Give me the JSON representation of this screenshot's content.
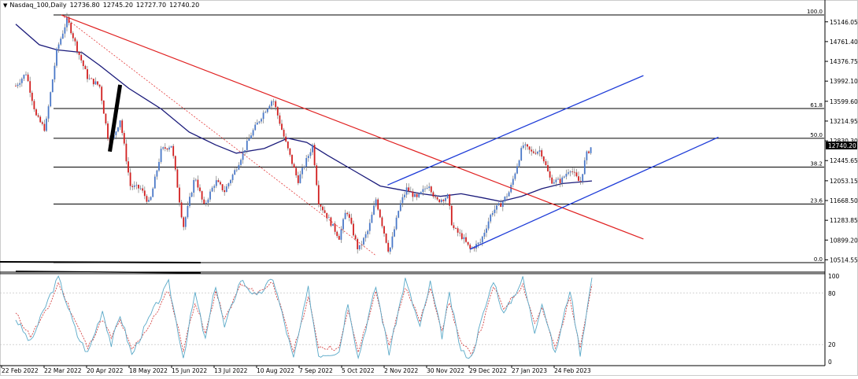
{
  "header": {
    "symbol": "Nasdaq_100,Daily",
    "ohlc": [
      "12736.80",
      "12745.20",
      "12727.70",
      "12740.20"
    ]
  },
  "colors": {
    "bull_candle": "#4a78c8",
    "bear_candle": "#d11f1f",
    "wick": "#777777",
    "moving_average": "#1a1a7a",
    "downtrend_line": "#e02020",
    "channel_lines": "#1e3cd8",
    "fib_lines": "#000000",
    "stoch_main": "#5aa9c8",
    "stoch_signal": "#d03030",
    "price_badge": "#000000"
  },
  "chart_data": [
    {
      "type": "candlestick",
      "symbol": "Nasdaq_100",
      "timeframe": "Daily",
      "last_price": "12740.20",
      "ylim": [
        10400,
        15500
      ],
      "price_axis_ticks": [
        "15146.05",
        "14761.40",
        "14376.75",
        "13992.10",
        "13599.60",
        "13214.95",
        "12830.30",
        "12445.65",
        "12053.15",
        "11668.50",
        "11283.85",
        "10899.20",
        "10514.55"
      ],
      "date_axis_labels": [
        "22 Feb 2022",
        "22 Mar 2022",
        "20 Apr 2022",
        "18 May 2022",
        "15 Jun 2022",
        "13 Jul 2022",
        "10 Aug 2022",
        "7 Sep 2022",
        "5 Oct 2022",
        "2 Nov 2022",
        "30 Nov 2022",
        "29 Dec 2022",
        "27 Jan 2023",
        "24 Feb 2023"
      ],
      "price_path": [
        [
          "2022-02-22",
          13900
        ],
        [
          "2022-03-01",
          14150
        ],
        [
          "2022-03-08",
          13300
        ],
        [
          "2022-03-14",
          13050
        ],
        [
          "2022-03-22",
          14600
        ],
        [
          "2022-03-29",
          15200
        ],
        [
          "2022-04-05",
          14600
        ],
        [
          "2022-04-12",
          14050
        ],
        [
          "2022-04-20",
          13900
        ],
        [
          "2022-04-26",
          12850
        ],
        [
          "2022-04-29",
          12850
        ],
        [
          "2022-05-04",
          13250
        ],
        [
          "2022-05-11",
          11950
        ],
        [
          "2022-05-18",
          11900
        ],
        [
          "2022-05-24",
          11600
        ],
        [
          "2022-06-01",
          12650
        ],
        [
          "2022-06-08",
          12750
        ],
        [
          "2022-06-16",
          11150
        ],
        [
          "2022-06-24",
          12150
        ],
        [
          "2022-06-30",
          11550
        ],
        [
          "2022-07-08",
          12050
        ],
        [
          "2022-07-14",
          11850
        ],
        [
          "2022-07-22",
          12300
        ],
        [
          "2022-08-01",
          12950
        ],
        [
          "2022-08-10",
          13400
        ],
        [
          "2022-08-16",
          13650
        ],
        [
          "2022-08-23",
          12950
        ],
        [
          "2022-08-29",
          12400
        ],
        [
          "2022-09-02",
          12050
        ],
        [
          "2022-09-12",
          12750
        ],
        [
          "2022-09-16",
          11650
        ],
        [
          "2022-09-23",
          11300
        ],
        [
          "2022-09-30",
          10950
        ],
        [
          "2022-10-05",
          11500
        ],
        [
          "2022-10-13",
          10700
        ],
        [
          "2022-10-20",
          11100
        ],
        [
          "2022-10-25",
          11700
        ],
        [
          "2022-11-03",
          10650
        ],
        [
          "2022-11-10",
          11550
        ],
        [
          "2022-11-15",
          11900
        ],
        [
          "2022-11-22",
          11700
        ],
        [
          "2022-11-30",
          12000
        ],
        [
          "2022-12-05",
          11650
        ],
        [
          "2022-12-13",
          11750
        ],
        [
          "2022-12-16",
          11150
        ],
        [
          "2022-12-23",
          10950
        ],
        [
          "2022-12-28",
          10720
        ],
        [
          "2023-01-04",
          10850
        ],
        [
          "2023-01-12",
          11450
        ],
        [
          "2023-01-18",
          11600
        ],
        [
          "2023-01-24",
          11850
        ],
        [
          "2023-02-02",
          12750
        ],
        [
          "2023-02-08",
          12600
        ],
        [
          "2023-02-14",
          12650
        ],
        [
          "2023-02-21",
          12050
        ],
        [
          "2023-02-28",
          12050
        ],
        [
          "2023-03-06",
          12300
        ],
        [
          "2023-03-13",
          12000
        ],
        [
          "2023-03-17",
          12550
        ],
        [
          "2023-03-21",
          12740
        ]
      ],
      "moving_average_path": [
        [
          "2022-02-22",
          15100
        ],
        [
          "2022-03-10",
          14700
        ],
        [
          "2022-03-22",
          14600
        ],
        [
          "2022-04-08",
          14550
        ],
        [
          "2022-04-20",
          14300
        ],
        [
          "2022-05-10",
          13850
        ],
        [
          "2022-06-01",
          13450
        ],
        [
          "2022-06-20",
          13000
        ],
        [
          "2022-07-08",
          12750
        ],
        [
          "2022-07-22",
          12590
        ],
        [
          "2022-08-10",
          12680
        ],
        [
          "2022-08-26",
          12880
        ],
        [
          "2022-09-08",
          12800
        ],
        [
          "2022-09-22",
          12550
        ],
        [
          "2022-10-10",
          12250
        ],
        [
          "2022-10-28",
          11950
        ],
        [
          "2022-11-10",
          11880
        ],
        [
          "2022-11-25",
          11800
        ],
        [
          "2022-12-08",
          11750
        ],
        [
          "2022-12-22",
          11800
        ],
        [
          "2023-01-06",
          11720
        ],
        [
          "2023-01-18",
          11650
        ],
        [
          "2023-02-01",
          11750
        ],
        [
          "2023-02-15",
          11900
        ],
        [
          "2023-03-01",
          12000
        ],
        [
          "2023-03-21",
          12050
        ]
      ],
      "fibonacci_levels": [
        {
          "label": "100.0",
          "price": 15280
        },
        {
          "label": "61.8",
          "price": 13460
        },
        {
          "label": "50.0",
          "price": 12880
        },
        {
          "label": "38.2",
          "price": 12320
        },
        {
          "label": "23.6",
          "price": 11600
        },
        {
          "label": "0.0",
          "price": 10460
        }
      ],
      "trendlines": [
        {
          "kind": "downtrend",
          "style": "solid",
          "from": [
            "2022-03-25",
            15280
          ],
          "to": [
            "2023-04-25",
            10920
          ]
        },
        {
          "kind": "downtrend",
          "style": "dotted",
          "from": [
            "2022-03-25",
            15280
          ],
          "to": [
            "2022-10-25",
            10600
          ]
        },
        {
          "kind": "channel-upper",
          "style": "solid",
          "from": [
            "2022-11-02",
            11970
          ],
          "to": [
            "2023-04-25",
            14100
          ]
        },
        {
          "kind": "channel-lower",
          "style": "solid",
          "from": [
            "2022-12-28",
            10720
          ],
          "to": [
            "2023-06-15",
            12900
          ]
        },
        {
          "kind": "marker",
          "style": "thick",
          "from": [
            "2022-04-27",
            12620
          ],
          "to": [
            "2022-05-04",
            13920
          ]
        }
      ]
    },
    {
      "type": "line",
      "indicator": "stochastic oscillator",
      "ylim": [
        0,
        100
      ],
      "axis_ticks": [
        "100",
        "80",
        "20",
        "0"
      ],
      "levels": [
        80,
        20
      ],
      "main_path": [
        [
          "2022-02-22",
          50
        ],
        [
          "2022-03-04",
          22
        ],
        [
          "2022-03-16",
          72
        ],
        [
          "2022-03-23",
          98
        ],
        [
          "2022-04-05",
          30
        ],
        [
          "2022-04-12",
          10
        ],
        [
          "2022-04-22",
          60
        ],
        [
          "2022-04-28",
          20
        ],
        [
          "2022-05-04",
          55
        ],
        [
          "2022-05-12",
          8
        ],
        [
          "2022-05-25",
          55
        ],
        [
          "2022-06-06",
          92
        ],
        [
          "2022-06-16",
          5
        ],
        [
          "2022-06-24",
          80
        ],
        [
          "2022-07-01",
          25
        ],
        [
          "2022-07-08",
          90
        ],
        [
          "2022-07-14",
          40
        ],
        [
          "2022-07-25",
          96
        ],
        [
          "2022-08-05",
          75
        ],
        [
          "2022-08-16",
          98
        ],
        [
          "2022-08-30",
          3
        ],
        [
          "2022-09-09",
          85
        ],
        [
          "2022-09-16",
          8
        ],
        [
          "2022-09-30",
          12
        ],
        [
          "2022-10-06",
          70
        ],
        [
          "2022-10-13",
          4
        ],
        [
          "2022-10-25",
          88
        ],
        [
          "2022-11-03",
          10
        ],
        [
          "2022-11-14",
          96
        ],
        [
          "2022-11-24",
          40
        ],
        [
          "2022-12-01",
          92
        ],
        [
          "2022-12-09",
          30
        ],
        [
          "2022-12-14",
          78
        ],
        [
          "2022-12-22",
          12
        ],
        [
          "2022-12-29",
          5
        ],
        [
          "2023-01-06",
          55
        ],
        [
          "2023-01-13",
          96
        ],
        [
          "2023-01-20",
          55
        ],
        [
          "2023-02-02",
          97
        ],
        [
          "2023-02-10",
          35
        ],
        [
          "2023-02-15",
          70
        ],
        [
          "2023-02-24",
          8
        ],
        [
          "2023-03-06",
          85
        ],
        [
          "2023-03-13",
          10
        ],
        [
          "2023-03-21",
          98
        ]
      ],
      "signal_path": [
        [
          "2022-02-22",
          56
        ],
        [
          "2022-03-04",
          30
        ],
        [
          "2022-03-16",
          62
        ],
        [
          "2022-03-23",
          92
        ],
        [
          "2022-04-05",
          42
        ],
        [
          "2022-04-12",
          16
        ],
        [
          "2022-04-22",
          50
        ],
        [
          "2022-04-28",
          28
        ],
        [
          "2022-05-04",
          48
        ],
        [
          "2022-05-12",
          14
        ],
        [
          "2022-05-25",
          45
        ],
        [
          "2022-06-06",
          84
        ],
        [
          "2022-06-16",
          14
        ],
        [
          "2022-06-24",
          70
        ],
        [
          "2022-07-01",
          32
        ],
        [
          "2022-07-08",
          82
        ],
        [
          "2022-07-14",
          48
        ],
        [
          "2022-07-25",
          90
        ],
        [
          "2022-08-05",
          80
        ],
        [
          "2022-08-16",
          93
        ],
        [
          "2022-08-30",
          12
        ],
        [
          "2022-09-09",
          75
        ],
        [
          "2022-09-16",
          18
        ],
        [
          "2022-09-30",
          15
        ],
        [
          "2022-10-06",
          60
        ],
        [
          "2022-10-13",
          12
        ],
        [
          "2022-10-25",
          80
        ],
        [
          "2022-11-03",
          18
        ],
        [
          "2022-11-14",
          88
        ],
        [
          "2022-11-24",
          48
        ],
        [
          "2022-12-01",
          85
        ],
        [
          "2022-12-09",
          38
        ],
        [
          "2022-12-14",
          70
        ],
        [
          "2022-12-22",
          20
        ],
        [
          "2022-12-29",
          10
        ],
        [
          "2023-01-06",
          45
        ],
        [
          "2023-01-13",
          88
        ],
        [
          "2023-01-20",
          62
        ],
        [
          "2023-02-02",
          90
        ],
        [
          "2023-02-10",
          45
        ],
        [
          "2023-02-15",
          62
        ],
        [
          "2023-02-24",
          15
        ],
        [
          "2023-03-06",
          75
        ],
        [
          "2023-03-13",
          18
        ],
        [
          "2023-03-21",
          90
        ]
      ]
    }
  ]
}
